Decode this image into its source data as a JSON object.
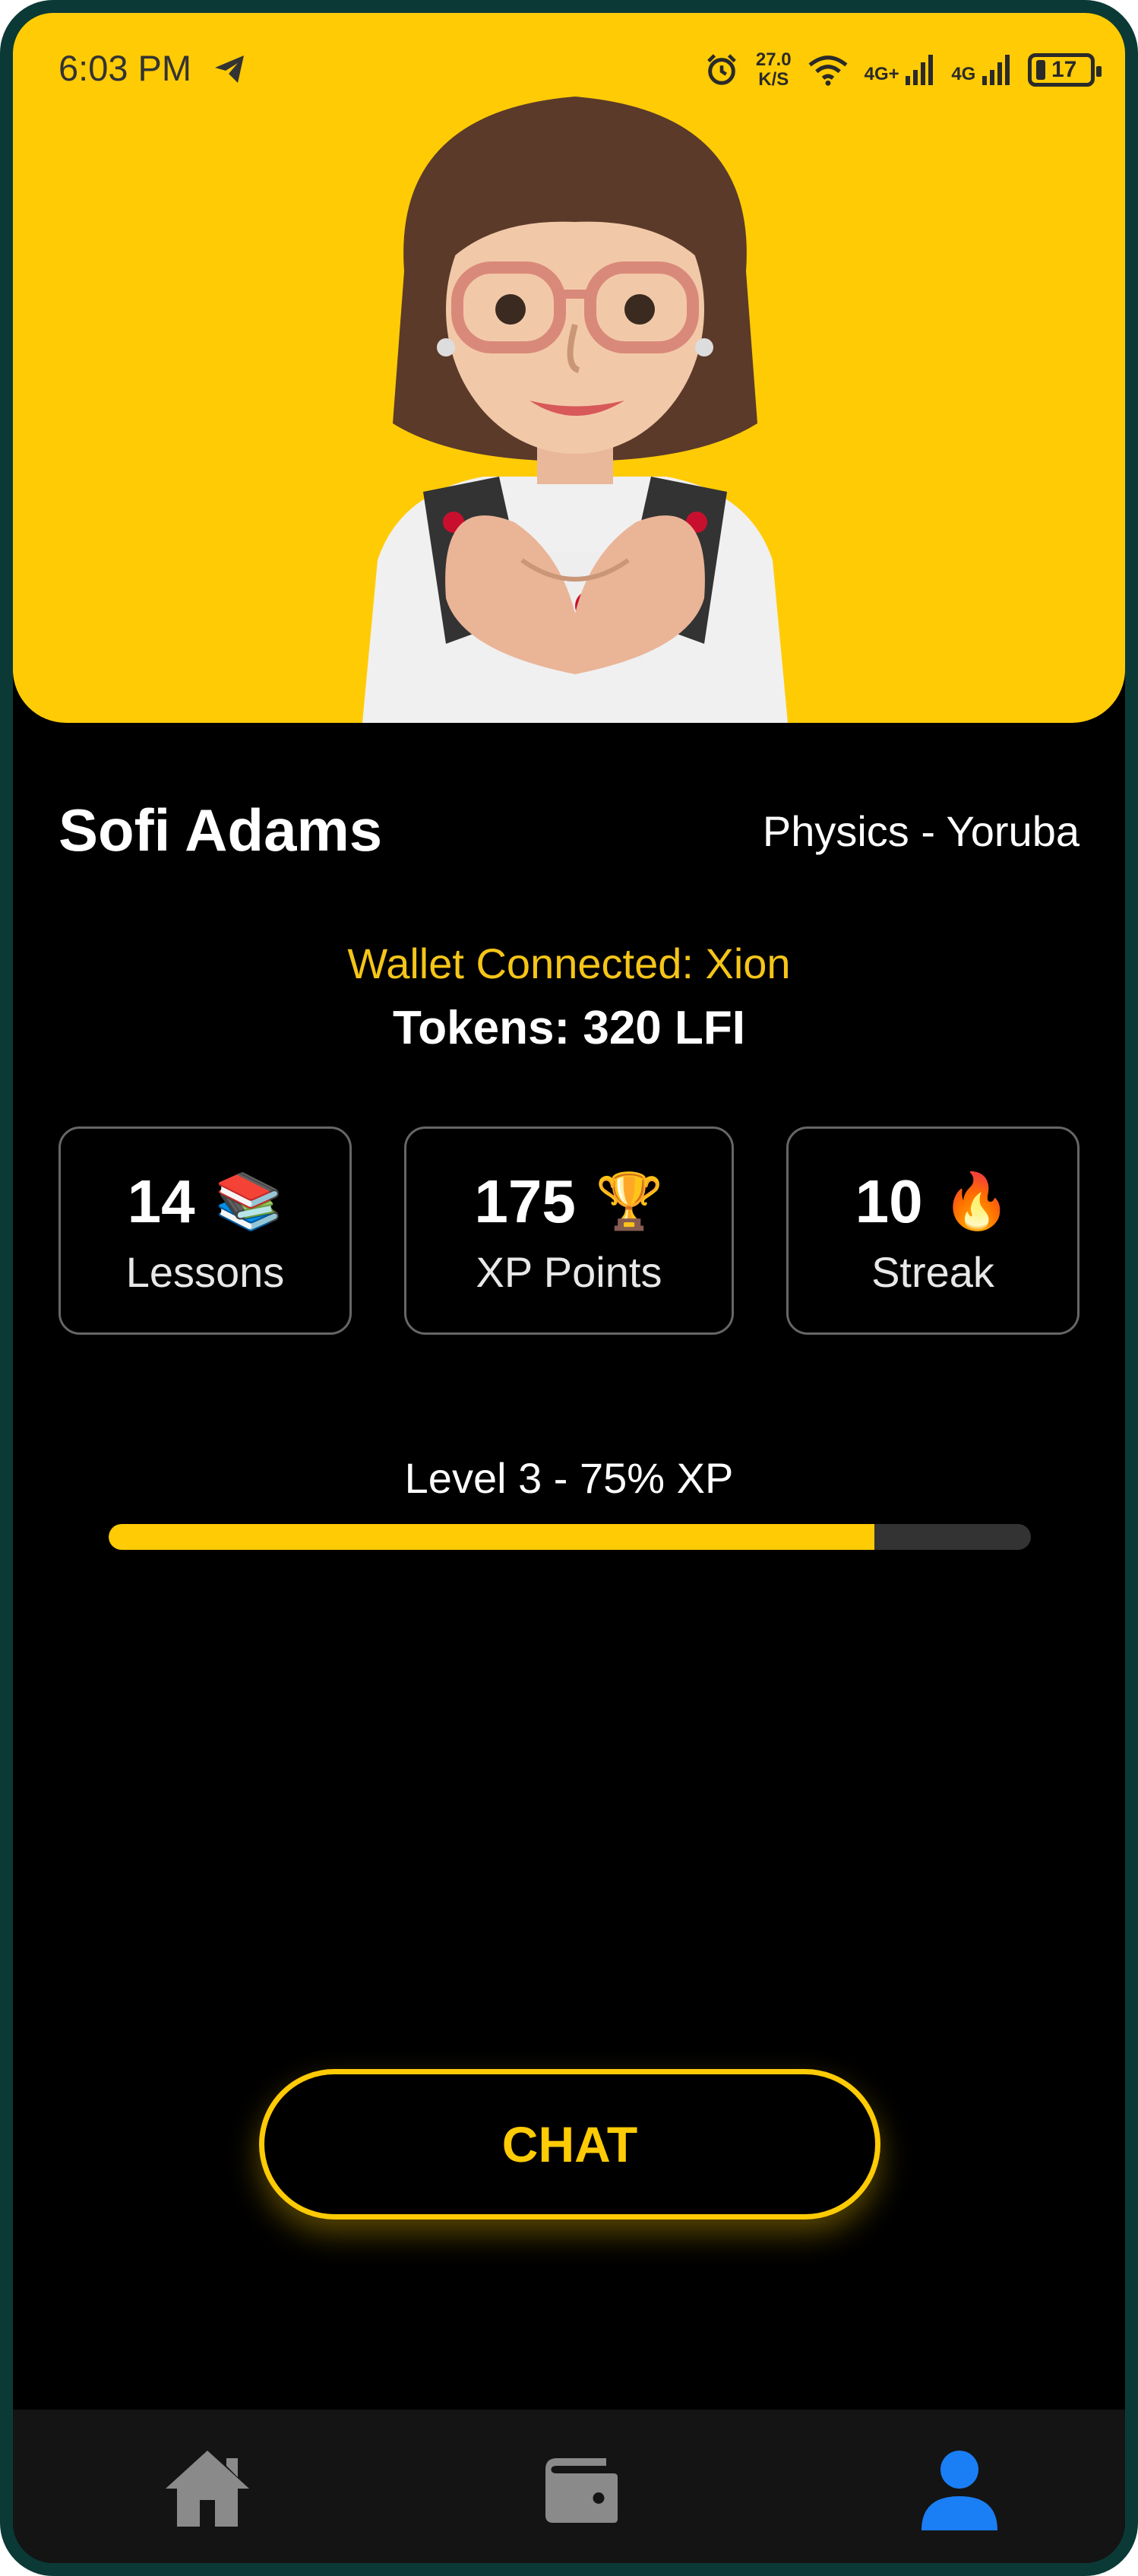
{
  "status_bar": {
    "time": "6:03 PM",
    "speed_value": "27.0",
    "speed_unit": "K/S",
    "network_1": "4G+",
    "network_2": "4G",
    "battery": "17"
  },
  "profile": {
    "name": "Sofi Adams",
    "subject": "Physics - Yoruba",
    "wallet_status": "Wallet Connected: Xion",
    "tokens": "Tokens: 320 LFI"
  },
  "stats": [
    {
      "value": "14",
      "emoji": "📚",
      "label": "Lessons",
      "icon": "books-icon"
    },
    {
      "value": "175",
      "emoji": "🏆",
      "label": "XP Points",
      "icon": "trophy-icon"
    },
    {
      "value": "10",
      "emoji": "🔥",
      "label": "Streak",
      "icon": "fire-icon"
    }
  ],
  "level": {
    "label": "Level 3 - 75% XP",
    "progress": 0.83
  },
  "chat_button": "CHAT",
  "nav": [
    {
      "icon": "home-icon",
      "active": false
    },
    {
      "icon": "wallet-icon",
      "active": false
    },
    {
      "icon": "profile-icon",
      "active": true
    }
  ],
  "colors": {
    "accent": "#ffcb05",
    "background": "#000000",
    "nav_active": "#1a7ef5",
    "nav_inactive": "#8a8a8a"
  }
}
